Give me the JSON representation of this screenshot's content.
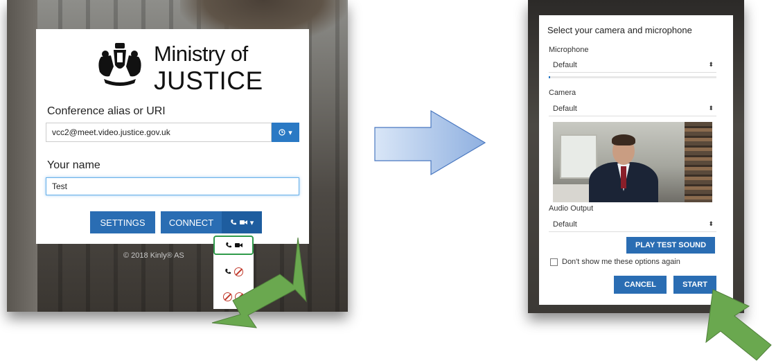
{
  "left_screen": {
    "logo": {
      "line1": "Ministry of",
      "line2": "JUSTICE"
    },
    "alias_label": "Conference alias or URI",
    "alias_value": "vcc2@meet.video.justice.gov.uk",
    "history_icon": "clock-icon",
    "name_label": "Your name",
    "name_value": "Test",
    "settings_label": "SETTINGS",
    "connect_label": "CONNECT",
    "connect_icons": [
      "phone-icon",
      "video-icon",
      "caret-down-icon"
    ],
    "copyright": "© 2018 Kinly® AS",
    "call_options": [
      {
        "name": "audio-and-video",
        "icons": [
          "phone-icon",
          "video-icon"
        ],
        "selected": true
      },
      {
        "name": "audio-only",
        "icons": [
          "phone-icon",
          "no-video-icon"
        ],
        "selected": false
      },
      {
        "name": "no-audio-no-video",
        "icons": [
          "no-phone-icon",
          "no-video-icon"
        ],
        "selected": false
      }
    ]
  },
  "right_screen": {
    "dialog_title": "Select your camera and microphone",
    "microphone_label": "Microphone",
    "microphone_value": "Default",
    "mic_level": 0.01,
    "camera_label": "Camera",
    "camera_value": "Default",
    "audio_output_label": "Audio Output",
    "audio_output_value": "Default",
    "play_test_sound_label": "PLAY TEST SOUND",
    "dont_show_label": "Don't show me these options again",
    "dont_show_checked": false,
    "cancel_label": "CANCEL",
    "start_label": "START"
  },
  "colors": {
    "primary_button": "#2a6db3",
    "highlight_green": "#2f9a4a",
    "pointer_arrow": "#6aa84f",
    "flow_arrow_fill": "#a9c4ea"
  }
}
